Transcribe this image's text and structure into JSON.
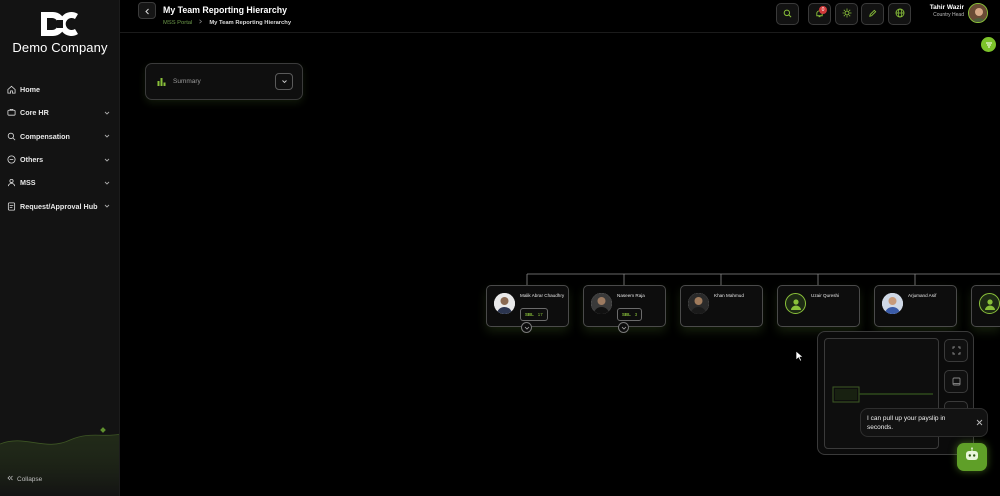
{
  "app": {
    "company_name": "Demo Company",
    "logo_text": "DC"
  },
  "sidebar": {
    "items": [
      {
        "label": "Home",
        "icon": "home-icon",
        "has_submenu": false
      },
      {
        "label": "Core HR",
        "icon": "folder-icon",
        "has_submenu": true
      },
      {
        "label": "Compensation",
        "icon": "money-search-icon",
        "has_submenu": true
      },
      {
        "label": "Others",
        "icon": "grid-circle-icon",
        "has_submenu": true
      },
      {
        "label": "MSS",
        "icon": "people-icon",
        "has_submenu": true
      },
      {
        "label": "Request/Approval Hub",
        "icon": "document-icon",
        "has_submenu": true
      }
    ],
    "collapse_label": "Collapse"
  },
  "header": {
    "title": "My Team Reporting Hierarchy",
    "breadcrumb": [
      "MSS Portal",
      "My Team Reporting Hierarchy"
    ],
    "notification_count": "0",
    "user_name": "Tahir Wazir",
    "user_role": "Country Head"
  },
  "summary": {
    "label": "Summary"
  },
  "org_chart": {
    "nodes": [
      {
        "name": "Malik Abrar Chaudhry",
        "count_tag": "SBL",
        "count": "17",
        "avatar": "photo",
        "has_children": true
      },
      {
        "name": "Naseem Raja",
        "count_tag": "SBL",
        "count": "3",
        "avatar": "photo",
        "has_children": true
      },
      {
        "name": "Khan Mahmud",
        "count_tag": "",
        "count": "",
        "avatar": "photo",
        "has_children": false
      },
      {
        "name": "Uzair Qureshi",
        "count_tag": "",
        "count": "",
        "avatar": "placeholder",
        "has_children": false
      },
      {
        "name": "Arjumand Asif",
        "count_tag": "",
        "count": "",
        "avatar": "photo",
        "has_children": false
      },
      {
        "name": "",
        "count_tag": "",
        "count": "",
        "avatar": "placeholder",
        "has_children": false
      }
    ]
  },
  "assistant": {
    "message": "I can pull up your payslip in seconds."
  },
  "colors": {
    "accent": "#8ac13a",
    "background": "#000000",
    "sidebar": "#131313"
  }
}
